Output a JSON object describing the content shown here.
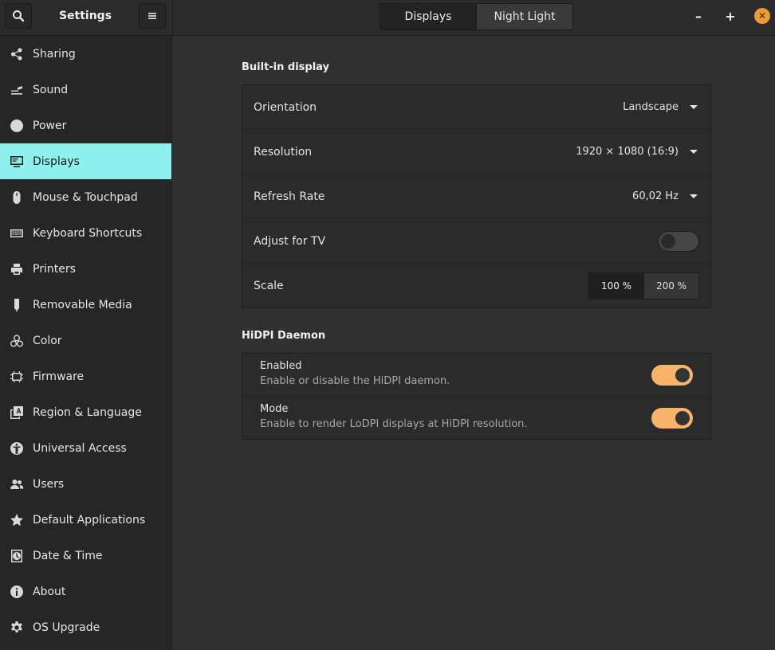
{
  "header": {
    "title": "Settings",
    "tabs": [
      {
        "label": "Displays",
        "active": true
      },
      {
        "label": "Night Light",
        "active": false
      }
    ],
    "window_controls": {
      "minimize": "–",
      "maximize": "+",
      "close": "✕"
    }
  },
  "sidebar": {
    "items": [
      {
        "label": "Sharing",
        "icon": "share-icon"
      },
      {
        "label": "Sound",
        "icon": "sound-icon"
      },
      {
        "label": "Power",
        "icon": "power-icon"
      },
      {
        "label": "Displays",
        "icon": "display-icon",
        "selected": true
      },
      {
        "label": "Mouse & Touchpad",
        "icon": "mouse-icon"
      },
      {
        "label": "Keyboard Shortcuts",
        "icon": "keyboard-icon"
      },
      {
        "label": "Printers",
        "icon": "printer-icon"
      },
      {
        "label": "Removable Media",
        "icon": "usb-icon"
      },
      {
        "label": "Color",
        "icon": "color-icon"
      },
      {
        "label": "Firmware",
        "icon": "chip-icon"
      },
      {
        "label": "Region & Language",
        "icon": "language-icon"
      },
      {
        "label": "Universal Access",
        "icon": "accessibility-icon"
      },
      {
        "label": "Users",
        "icon": "users-icon"
      },
      {
        "label": "Default Applications",
        "icon": "star-icon"
      },
      {
        "label": "Date & Time",
        "icon": "clock-icon"
      },
      {
        "label": "About",
        "icon": "info-icon"
      },
      {
        "label": "OS Upgrade",
        "icon": "gear-icon"
      }
    ]
  },
  "builtin": {
    "title": "Built-in display",
    "orientation": {
      "label": "Orientation",
      "value": "Landscape"
    },
    "resolution": {
      "label": "Resolution",
      "value": "1920 × 1080 (16:9)"
    },
    "refresh": {
      "label": "Refresh Rate",
      "value": "60,02 Hz"
    },
    "adjust_tv": {
      "label": "Adjust for TV",
      "enabled": false
    },
    "scale": {
      "label": "Scale",
      "options": [
        "100 %",
        "200 %"
      ],
      "selected": "100 %"
    }
  },
  "hidpi": {
    "title": "HiDPI Daemon",
    "enabled": {
      "title": "Enabled",
      "description": "Enable or disable the HiDPI daemon.",
      "on": true
    },
    "mode": {
      "title": "Mode",
      "description": "Enable to render LoDPI displays at HiDPI resolution.",
      "on": true
    }
  },
  "colors": {
    "accent": "#8ef0ec",
    "toggle_on": "#f6b469",
    "close": "#f09a35"
  }
}
